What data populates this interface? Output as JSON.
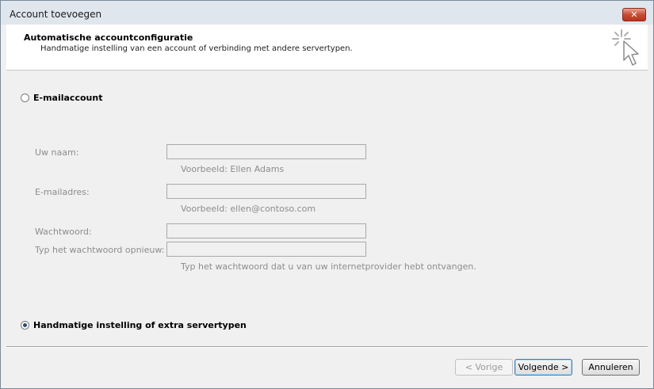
{
  "window": {
    "title": "Account toevoegen",
    "close_label": "✕"
  },
  "header": {
    "title": "Automatische accountconfiguratie",
    "subtitle": "Handmatige instelling van een account of verbinding met andere servertypen."
  },
  "email_option": {
    "label": "E-mailaccount",
    "selected": false
  },
  "form": {
    "name_label": "Uw naam:",
    "name_value": "",
    "name_hint": "Voorbeeld: Ellen Adams",
    "email_label": "E-mailadres:",
    "email_value": "",
    "email_hint": "Voorbeeld: ellen@contoso.com",
    "password_label": "Wachtwoord:",
    "password_value": "",
    "password_repeat_label": "Typ het wachtwoord opnieuw:",
    "password_repeat_value": "",
    "password_hint": "Typ het wachtwoord dat u van uw internetprovider hebt ontvangen."
  },
  "manual_option": {
    "label": "Handmatige instelling of extra servertypen",
    "selected": true
  },
  "buttons": {
    "back": "< Vorige",
    "next": "Volgende >",
    "cancel": "Annuleren"
  },
  "icons": {
    "close": "close-icon",
    "wizard": "wizard-cursor-icon"
  }
}
